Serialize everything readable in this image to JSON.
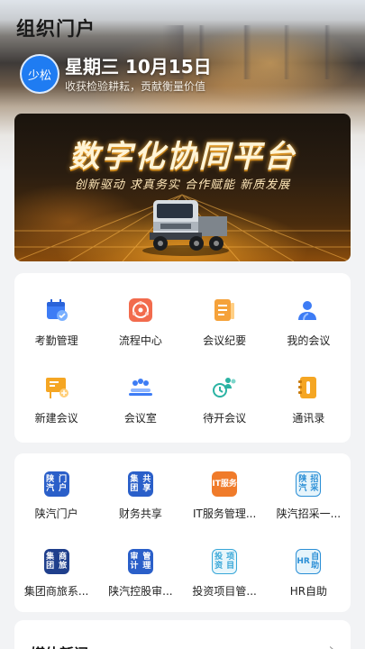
{
  "header": {
    "title": "组织门户",
    "avatar_text": "少松",
    "date": "星期三 10月15日",
    "motto": "收获检验耕耘，贡献衡量价值"
  },
  "banner": {
    "title": "数字化协同平台",
    "subtitle": "创新驱动  求真务实  合作赋能  新质发展"
  },
  "quick_apps": [
    {
      "label": "考勤管理",
      "icon": "calendar-check-icon",
      "color": "#3d7cf5"
    },
    {
      "label": "流程中心",
      "icon": "flow-circle-icon",
      "color": "#f26b4d"
    },
    {
      "label": "会议纪要",
      "icon": "notes-icon",
      "color": "#f5a23a"
    },
    {
      "label": "我的会议",
      "icon": "user-meeting-icon",
      "color": "#3d7cf5"
    },
    {
      "label": "新建会议",
      "icon": "new-board-icon",
      "color": "#f5a623"
    },
    {
      "label": "会议室",
      "icon": "meeting-room-icon",
      "color": "#3d7cf5"
    },
    {
      "label": "待开会议",
      "icon": "pending-meeting-icon",
      "color": "#2bb3a3"
    },
    {
      "label": "通讯录",
      "icon": "address-book-icon",
      "color": "#f5a623"
    }
  ],
  "system_apps": [
    {
      "label": "陕汽门户",
      "badge": "陕汽\n门户",
      "bg": "#2a5fc9",
      "fg": "#ffffff",
      "icon": "shaanqi-portal-icon"
    },
    {
      "label": "财务共享",
      "badge": "集团\n共享",
      "bg": "#2a5fc9",
      "fg": "#ffffff",
      "icon": "finance-share-icon"
    },
    {
      "label": "IT服务管理...",
      "badge": "IT\n服务",
      "bg": "#f07b2a",
      "fg": "#ffffff",
      "icon": "it-service-icon"
    },
    {
      "label": "陕汽招采一...",
      "badge": "陕汽\n招采",
      "bg": "#e6f4fb",
      "fg": "#2b8fd6",
      "icon": "procurement-icon"
    },
    {
      "label": "集团商旅系...",
      "badge": "集团\n商旅",
      "bg": "#1f3f8c",
      "fg": "#ffffff",
      "icon": "travel-icon"
    },
    {
      "label": "陕汽控股审...",
      "badge": "审计\n管理",
      "bg": "#2a5fc9",
      "fg": "#ffffff",
      "icon": "audit-icon"
    },
    {
      "label": "投资项目管...",
      "badge": "投资\n项目",
      "bg": "#e8f6fb",
      "fg": "#38a7d8",
      "icon": "investment-icon"
    },
    {
      "label": "HR自助",
      "badge": "HR\n自助",
      "bg": "#e6f4fb",
      "fg": "#2b8fd6",
      "icon": "hr-self-service-icon"
    }
  ],
  "news": {
    "title": "媒体新闻",
    "more": "›"
  }
}
